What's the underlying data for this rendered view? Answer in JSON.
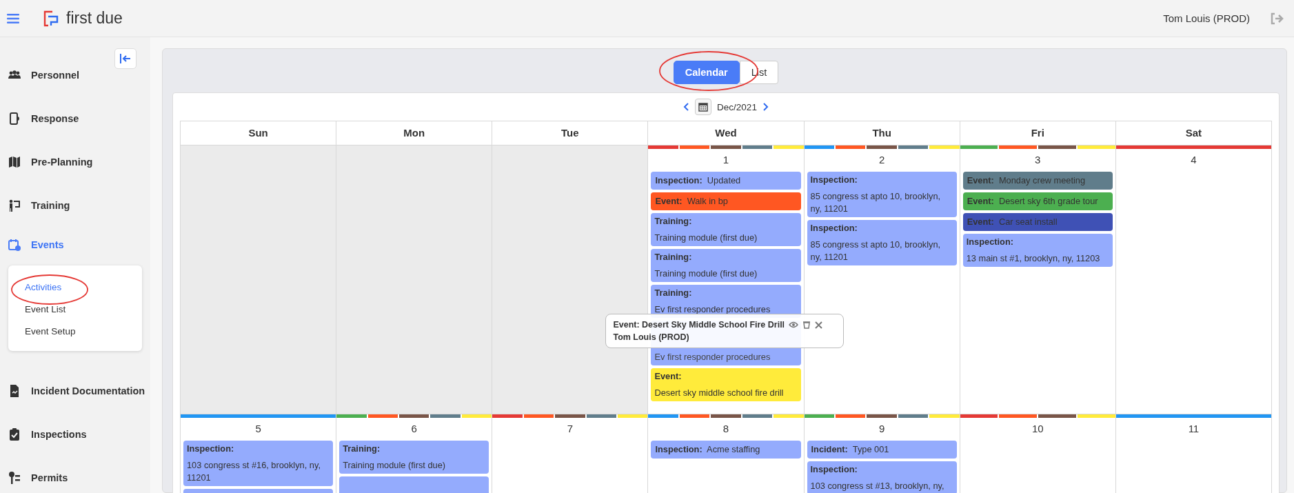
{
  "topbar": {
    "brand": "first due",
    "user": "Tom Louis (PROD)"
  },
  "sidebar": {
    "items": [
      {
        "label": "Personnel",
        "selected": false
      },
      {
        "label": "Response",
        "selected": false
      },
      {
        "label": "Pre-Planning",
        "selected": false
      },
      {
        "label": "Training",
        "selected": false
      },
      {
        "label": "Events",
        "selected": true,
        "children": [
          {
            "label": "Activities",
            "selected": true
          },
          {
            "label": "Event List",
            "selected": false
          },
          {
            "label": "Event Setup",
            "selected": false
          }
        ]
      },
      {
        "label": "Incident Documentation",
        "selected": false
      },
      {
        "label": "Inspections",
        "selected": false
      },
      {
        "label": "Permits",
        "selected": false
      }
    ]
  },
  "view_toggle": [
    {
      "label": "Calendar",
      "selected": true
    },
    {
      "label": "List",
      "selected": false
    }
  ],
  "month_nav": {
    "label": "Dec/2021"
  },
  "calendar": {
    "weekdays": [
      "Sun",
      "Mon",
      "Tue",
      "Wed",
      "Thu",
      "Fri",
      "Sat"
    ],
    "weeks": [
      {
        "days": [
          {
            "outside": true
          },
          {
            "outside": true
          },
          {
            "outside": true
          },
          {
            "outside": false,
            "date": "1",
            "bars": [
              {
                "color": "#e53935"
              },
              {
                "color": "#ff5722"
              },
              {
                "color": "#795548"
              },
              {
                "color": "#607d8b"
              },
              {
                "color": "#ffeb3b"
              }
            ],
            "events": [
              {
                "kind": "inline",
                "label": "Inspection:",
                "text": "Updated",
                "color": "#94abfd"
              },
              {
                "kind": "inline",
                "label": "Event:",
                "text": "Walk in bp",
                "color": "#ff5722"
              },
              {
                "kind": "stacked",
                "label": "Training:",
                "text": "Training module (first due)",
                "color": "#94abfd"
              },
              {
                "kind": "stacked",
                "label": "Training:",
                "text": "Training module (first due)",
                "color": "#94abfd"
              },
              {
                "kind": "stacked",
                "label": "Training:",
                "text": "Ev first responder procedures",
                "color": "#94abfd"
              },
              {
                "kind": "covered",
                "text": "Ev first responder procedures",
                "color": "#94abfd"
              },
              {
                "kind": "stacked",
                "label": "Event:",
                "text": "Desert sky middle school fire drill",
                "color": "#ffeb3b"
              }
            ]
          },
          {
            "outside": false,
            "date": "2",
            "bars": [
              {
                "color": "#2196f3"
              },
              {
                "color": "#ff5722"
              },
              {
                "color": "#795548"
              },
              {
                "color": "#607d8b"
              },
              {
                "color": "#ffeb3b"
              }
            ],
            "events": [
              {
                "kind": "stacked",
                "label": "Inspection:",
                "text": "85 congress st apto 10, brooklyn, ny, 11201",
                "color": "#94abfd"
              },
              {
                "kind": "stacked",
                "label": "Inspection:",
                "text": "85 congress st apto 10, brooklyn, ny, 11201",
                "color": "#94abfd"
              }
            ]
          },
          {
            "outside": false,
            "date": "3",
            "bars": [
              {
                "color": "#4caf50"
              },
              {
                "color": "#ff5722"
              },
              {
                "color": "#795548"
              },
              {
                "color": "#ffeb3b"
              }
            ],
            "events": [
              {
                "kind": "inline",
                "label": "Event:",
                "text": "Monday crew meeting",
                "color": "#607d8b"
              },
              {
                "kind": "inline",
                "label": "Event:",
                "text": "Desert sky 6th grade tour",
                "color": "#4caf50"
              },
              {
                "kind": "inline",
                "label": "Event:",
                "text": "Car seat install",
                "color": "#3f51b5"
              },
              {
                "kind": "stacked",
                "label": "Inspection:",
                "text": "13 main st #1, brooklyn, ny, 11203",
                "color": "#94abfd"
              }
            ]
          },
          {
            "outside": false,
            "date": "4",
            "bars": [
              {
                "color": "#e53935"
              }
            ]
          }
        ]
      },
      {
        "days": [
          {
            "outside": false,
            "date": "5",
            "bars": [
              {
                "color": "#2196f3"
              }
            ],
            "events": [
              {
                "kind": "stacked",
                "label": "Inspection:",
                "text": "103 congress st #16, brooklyn, ny, 11201",
                "color": "#94abfd"
              },
              {
                "kind": "stacked",
                "color": "#94abfd"
              }
            ]
          },
          {
            "outside": false,
            "date": "6",
            "bars": [
              {
                "color": "#4caf50"
              },
              {
                "color": "#ff5722"
              },
              {
                "color": "#795548"
              },
              {
                "color": "#607d8b"
              },
              {
                "color": "#ffeb3b"
              }
            ],
            "events": [
              {
                "kind": "stacked",
                "label": "Training:",
                "text": "Training module (first due)",
                "color": "#94abfd"
              },
              {
                "kind": "stacked",
                "color": "#94abfd"
              }
            ]
          },
          {
            "outside": false,
            "date": "7",
            "bars": [
              {
                "color": "#e53935"
              },
              {
                "color": "#ff5722"
              },
              {
                "color": "#795548"
              },
              {
                "color": "#607d8b"
              },
              {
                "color": "#ffeb3b"
              }
            ]
          },
          {
            "outside": false,
            "date": "8",
            "bars": [
              {
                "color": "#2196f3"
              },
              {
                "color": "#ff5722"
              },
              {
                "color": "#795548"
              },
              {
                "color": "#607d8b"
              },
              {
                "color": "#ffeb3b"
              }
            ],
            "events": [
              {
                "kind": "inline",
                "label": "Inspection:",
                "text": "Acme staffing",
                "color": "#94abfd"
              }
            ]
          },
          {
            "outside": false,
            "date": "9",
            "bars": [
              {
                "color": "#4caf50"
              },
              {
                "color": "#ff5722"
              },
              {
                "color": "#795548"
              },
              {
                "color": "#607d8b"
              },
              {
                "color": "#ffeb3b"
              }
            ],
            "events": [
              {
                "kind": "inline",
                "label": "Incident:",
                "text": "Type 001",
                "color": "#94abfd"
              },
              {
                "kind": "stacked",
                "label": "Inspection:",
                "text": "103 congress st #13, brooklyn, ny,",
                "color": "#94abfd"
              }
            ]
          },
          {
            "outside": false,
            "date": "10",
            "bars": [
              {
                "color": "#e53935"
              },
              {
                "color": "#ff5722"
              },
              {
                "color": "#795548"
              },
              {
                "color": "#ffeb3b"
              }
            ]
          },
          {
            "outside": false,
            "date": "11",
            "bars": [
              {
                "color": "#2196f3"
              }
            ]
          }
        ]
      }
    ]
  },
  "tooltip": {
    "title": "Event: Desert Sky Middle School Fire Drill",
    "user": "Tom Louis (PROD)"
  }
}
